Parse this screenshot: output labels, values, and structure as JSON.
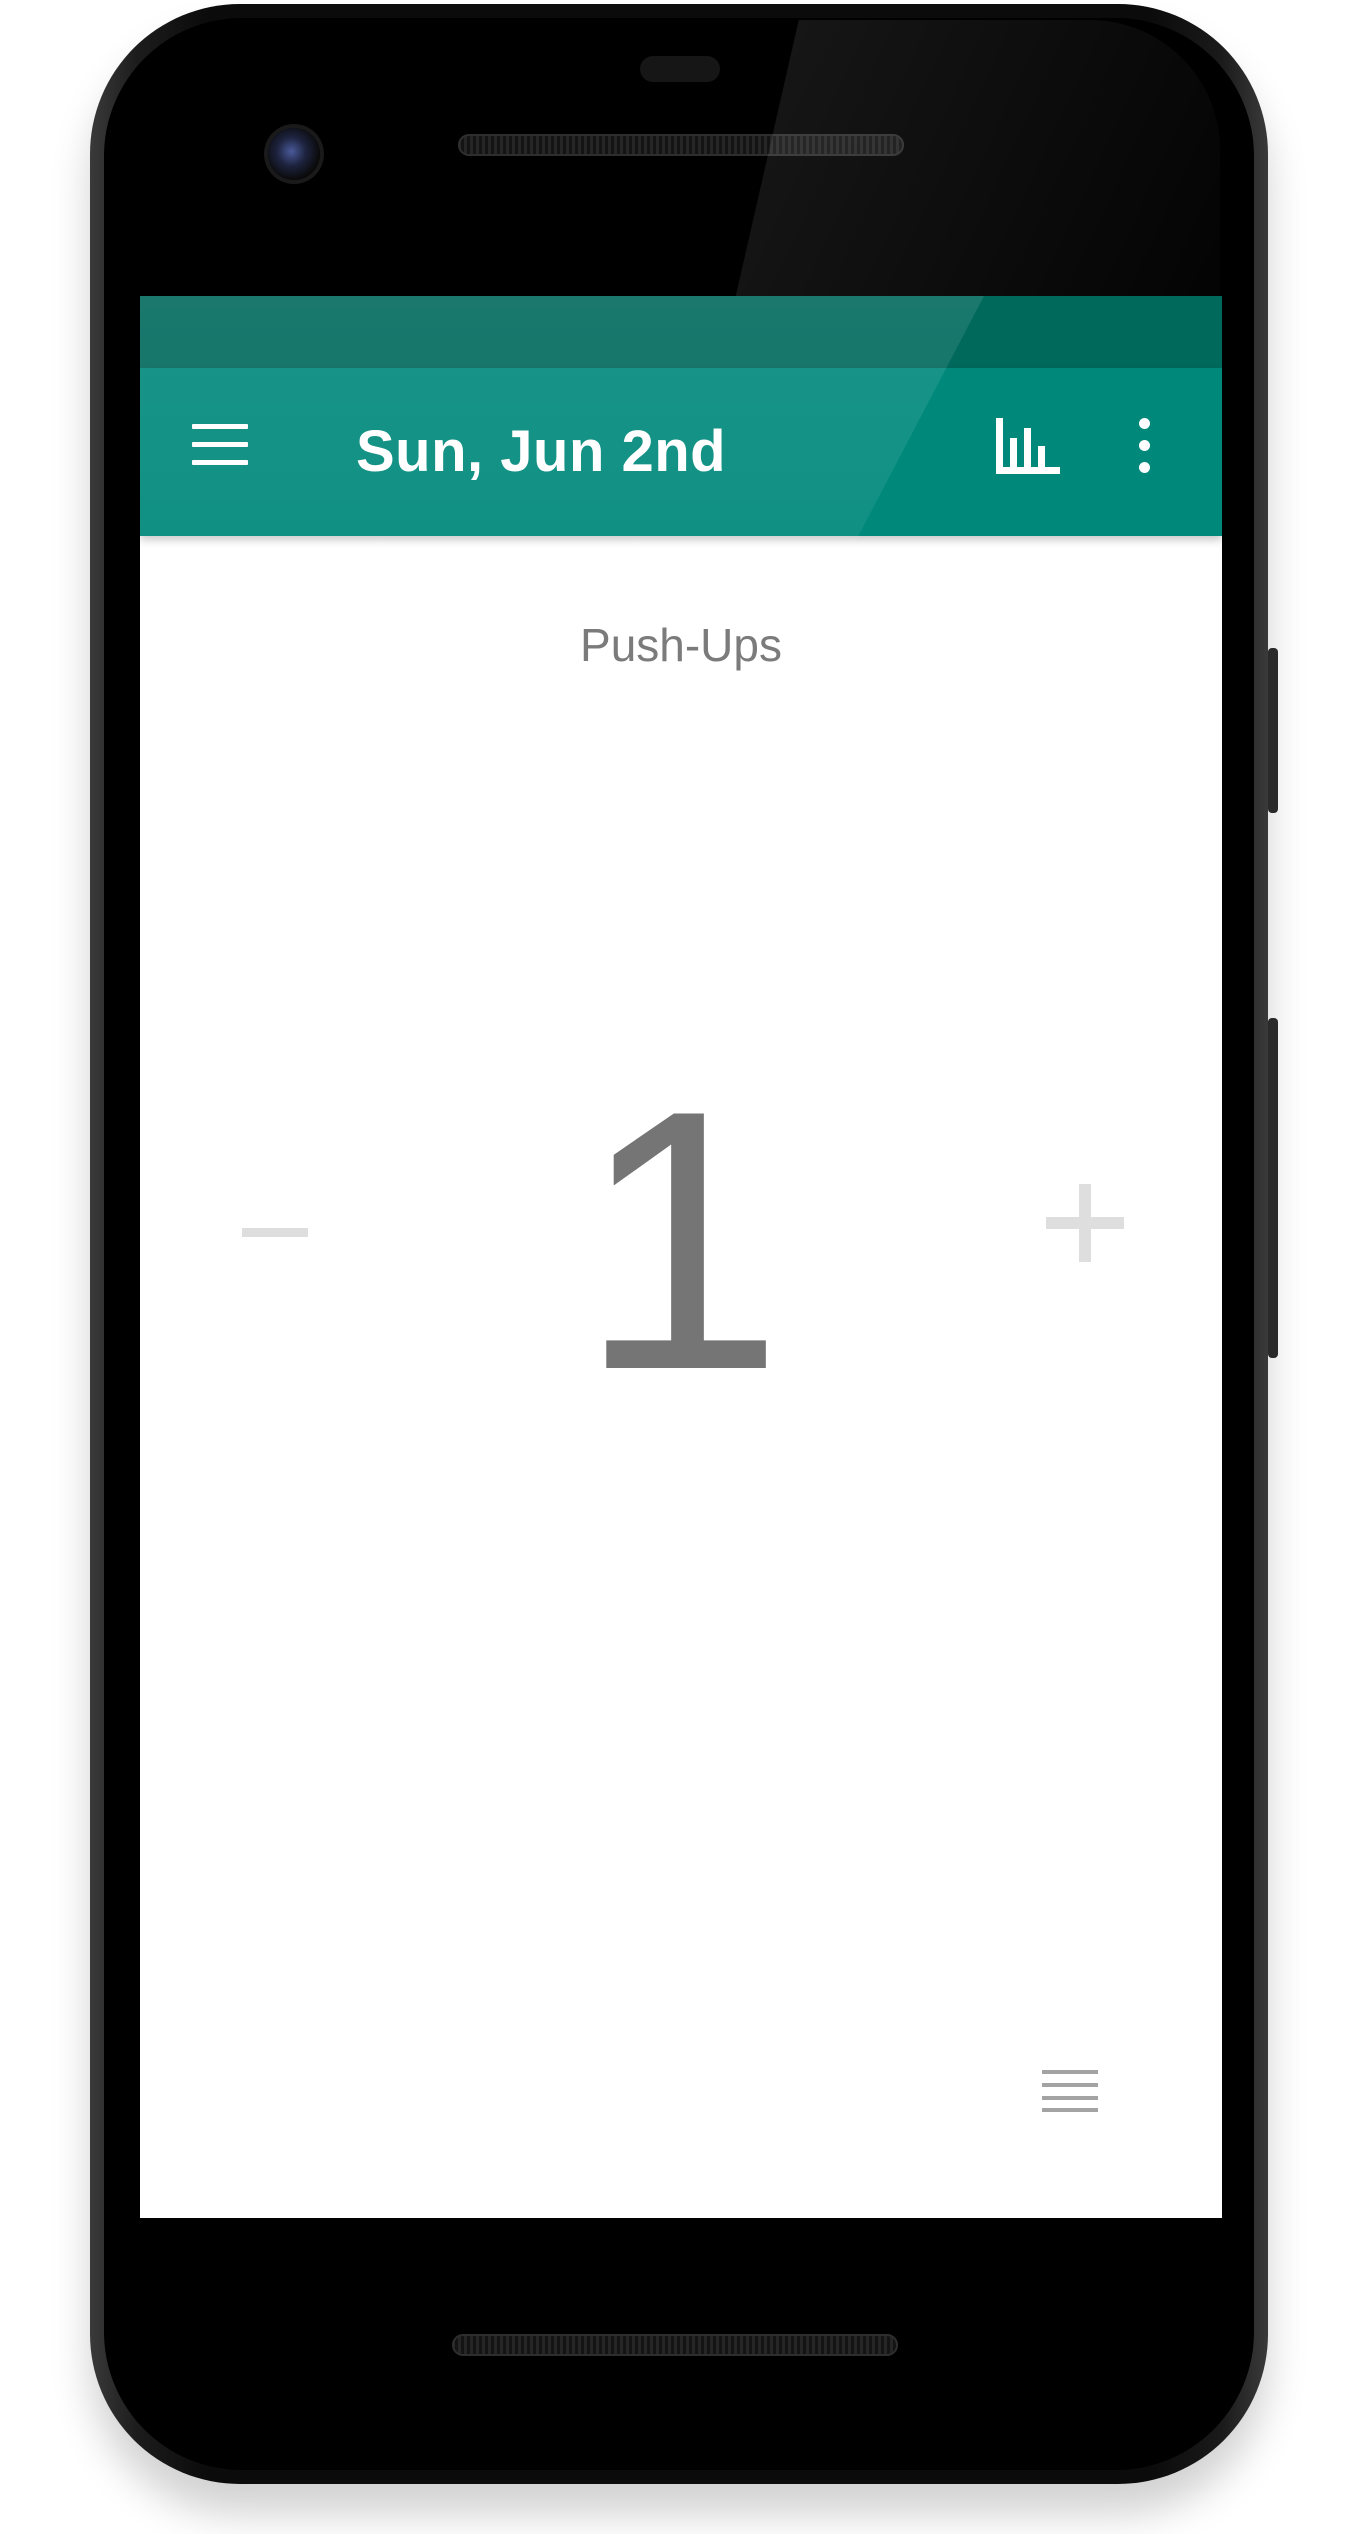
{
  "app_bar": {
    "title": "Sun, Jun 2nd",
    "color": "#00897b",
    "status_bar_color": "#00695c",
    "icons": [
      "menu-icon",
      "bar-chart-icon",
      "more-vert-icon"
    ]
  },
  "counter": {
    "name": "Push-Ups",
    "value": "1",
    "decrement_icon": "minus-icon",
    "increment_icon": "plus-icon"
  },
  "bottom": {
    "icon": "list-icon"
  }
}
